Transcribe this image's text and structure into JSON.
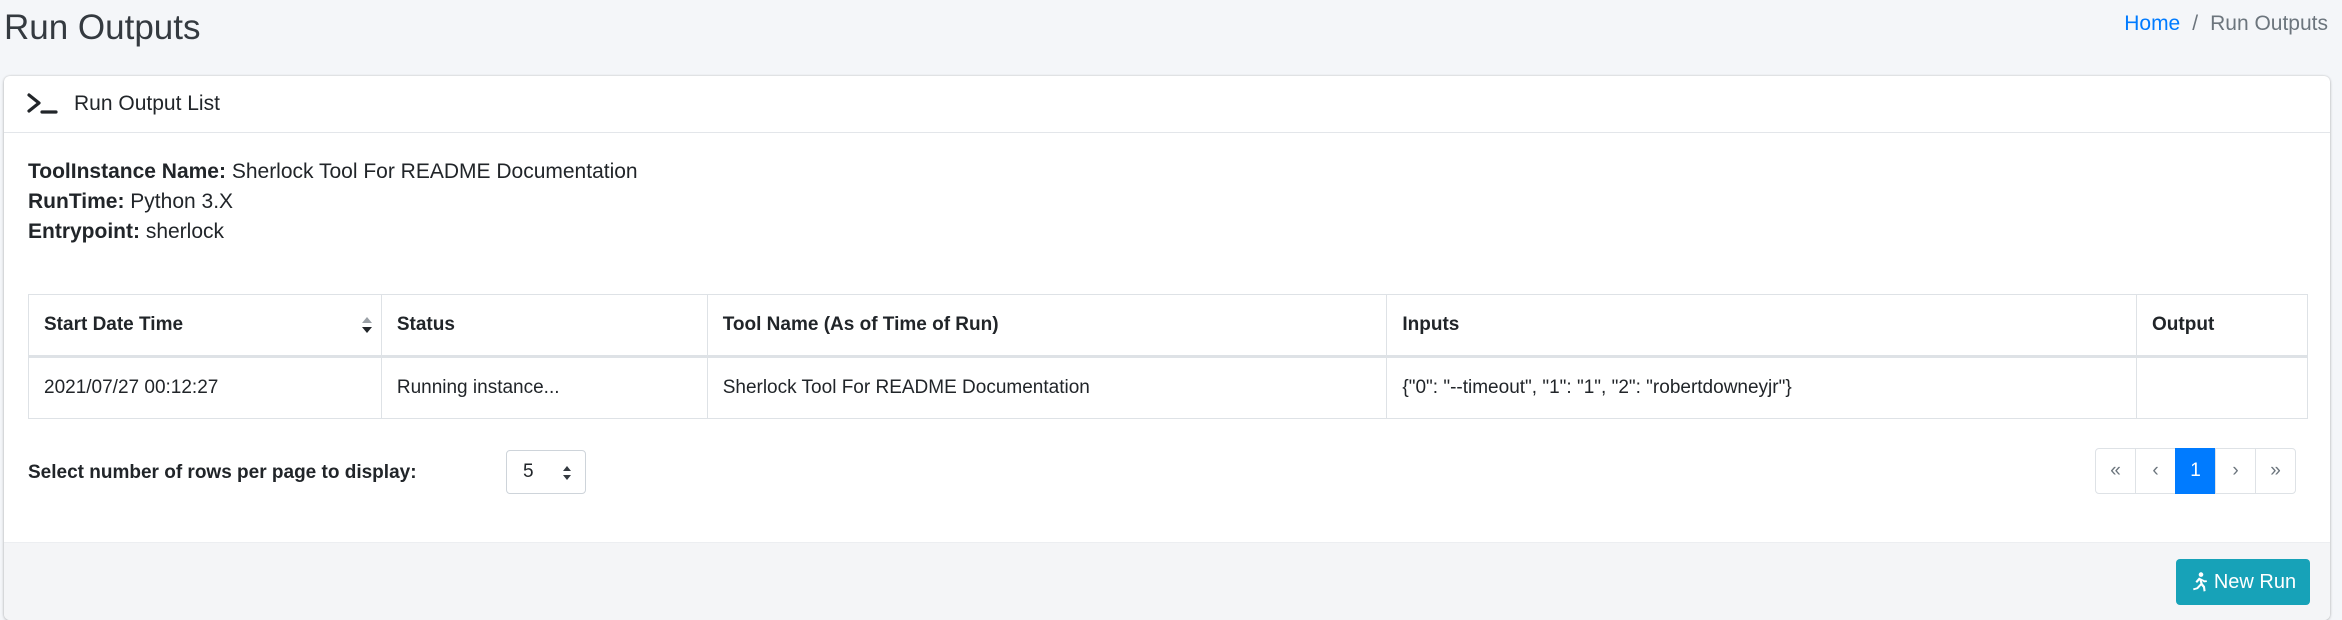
{
  "header": {
    "title": "Run Outputs",
    "breadcrumb": {
      "home": "Home",
      "separator": "/",
      "current": "Run Outputs"
    }
  },
  "card": {
    "title": "Run Output List",
    "icon": "terminal-icon",
    "info": {
      "tool_instance_label": "ToolInstance Name:",
      "tool_instance_value": "Sherlock Tool For README Documentation",
      "runtime_label": "RunTime:",
      "runtime_value": "Python 3.X",
      "entrypoint_label": "Entrypoint:",
      "entrypoint_value": "sherlock"
    },
    "table": {
      "columns": [
        "Start Date Time",
        "Status",
        "Tool Name (As of Time of Run)",
        "Inputs",
        "Output"
      ],
      "rows": [
        [
          "2021/07/27 00:12:27",
          "Running instance...",
          "Sherlock Tool For README Documentation",
          "{\"0\": \"--timeout\", \"1\": \"1\", \"2\": \"robertdowneyjr\"}",
          ""
        ]
      ]
    },
    "rows_per_page": {
      "label": "Select number of rows per page to display:",
      "value": "5"
    },
    "pagination": {
      "first": "«",
      "prev": "‹",
      "current": "1",
      "next": "›",
      "last": "»"
    },
    "footer": {
      "new_run_label": "New Run",
      "new_run_icon": "running-icon"
    }
  },
  "colors": {
    "primary": "#007bff",
    "info_button": "#17a2b8",
    "background": "#f4f6f9"
  }
}
